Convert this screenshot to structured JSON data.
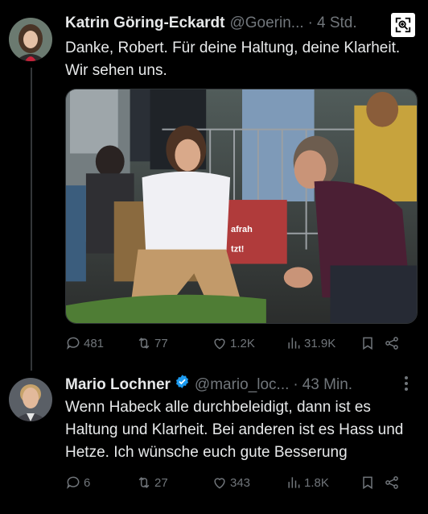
{
  "tweets": [
    {
      "name": "Katrin Göring-Eckardt",
      "handle": "@Goerin...",
      "separator": "·",
      "time": "4 Std.",
      "text": "Danke, Robert. Für deine Haltung, deine Klarheit. Wir sehen uns.",
      "stats": {
        "replies": "481",
        "retweets": "77",
        "likes": "1.2K",
        "views": "31.9K"
      }
    },
    {
      "name": "Mario Lochner",
      "handle": "@mario_loc...",
      "separator": "·",
      "time": "43 Min.",
      "verified": true,
      "text": "Wenn Habeck alle durchbeleidigt, dann ist es Haltung und Klarheit. Bei anderen ist es Hass und Hetze. Ich wünsche euch gute Besserung",
      "stats": {
        "replies": "6",
        "retweets": "27",
        "likes": "343",
        "views": "1.8K"
      }
    }
  ],
  "media_overlay_text": [
    "afrah",
    "tzt!"
  ],
  "icons": {
    "reply": "reply-icon",
    "retweet": "retweet-icon",
    "like": "heart-icon",
    "views": "views-icon",
    "bookmark": "bookmark-icon",
    "share": "share-icon",
    "zoom": "zoom-in-icon",
    "more": "more-icon",
    "verified": "verified-badge-icon"
  },
  "colors": {
    "background": "#000000",
    "text": "#e7e9ea",
    "muted": "#71767b",
    "verified": "#1d9bf0",
    "thread_line": "#333639"
  }
}
